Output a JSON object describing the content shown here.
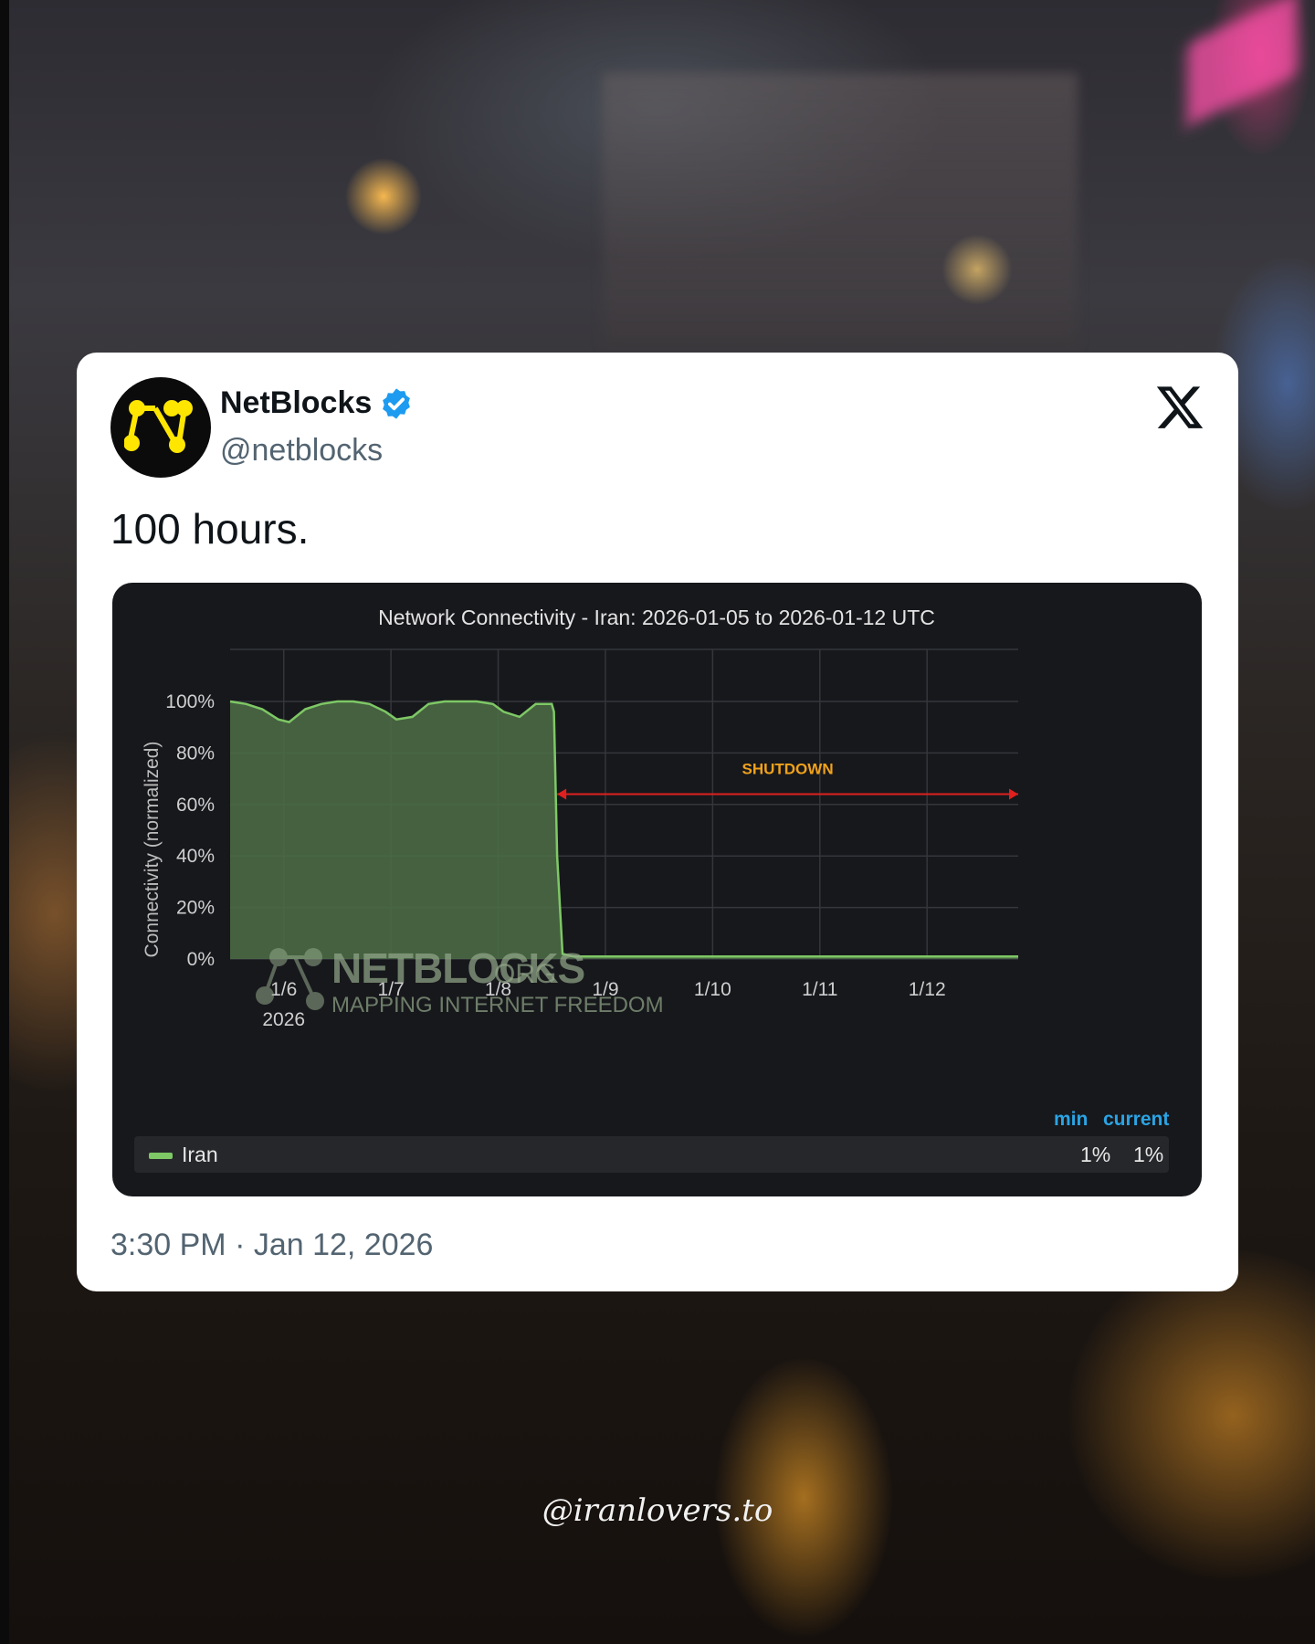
{
  "tweet": {
    "author_name": "NetBlocks",
    "author_handle": "@netblocks",
    "text": "100 hours.",
    "timestamp": "3:30 PM · Jan 12, 2026"
  },
  "overlay": {
    "handle": "@iranlovers.to"
  },
  "icons": {
    "avatar": "netblocks-logo-icon",
    "verified": "verified-badge-icon",
    "brand": "x-logo-icon"
  },
  "colors": {
    "area_fill": "#4d6e47",
    "area_line": "#7ec865",
    "annotation": "#e0201f",
    "annotation_text": "#f0a21b",
    "legend_header": "#2ba4e4",
    "verified": "#1d9bf0"
  },
  "chart_data": {
    "type": "area",
    "title": "Network Connectivity - Iran: 2026-01-05 to 2026-01-12 UTC",
    "ylabel": "Connectivity (normalized)",
    "xlabel": "",
    "ylim": [
      0,
      100
    ],
    "yticks": [
      "0%",
      "20%",
      "40%",
      "60%",
      "80%",
      "100%"
    ],
    "xtick_labels": [
      {
        "label": "1/6",
        "sub": "2026",
        "day": 6
      },
      {
        "label": "1/7",
        "sub": "",
        "day": 7
      },
      {
        "label": "1/8",
        "sub": "",
        "day": 8
      },
      {
        "label": "1/9",
        "sub": "",
        "day": 9
      },
      {
        "label": "1/10",
        "sub": "",
        "day": 10
      },
      {
        "label": "1/11",
        "sub": "",
        "day": 11
      },
      {
        "label": "1/12",
        "sub": "",
        "day": 12
      }
    ],
    "xlim_days": [
      5.5,
      12.85
    ],
    "grid": true,
    "series": [
      {
        "name": "Iran",
        "x_days": [
          5.5,
          5.65,
          5.8,
          5.95,
          6.05,
          6.2,
          6.35,
          6.5,
          6.65,
          6.8,
          6.95,
          7.05,
          7.2,
          7.35,
          7.5,
          7.65,
          7.8,
          7.95,
          8.05,
          8.2,
          8.35,
          8.45,
          8.5,
          8.52,
          8.55,
          8.6,
          8.7,
          9.0,
          10.0,
          11.0,
          12.0,
          12.85
        ],
        "values": [
          100,
          99,
          97,
          93,
          92,
          97,
          99,
          100,
          100,
          99,
          96,
          93,
          94,
          99,
          100,
          100,
          100,
          99,
          96,
          94,
          99,
          99,
          99,
          96,
          40,
          2,
          1,
          1,
          1,
          1,
          1,
          1
        ]
      }
    ],
    "annotations": [
      {
        "text": "SHUTDOWN",
        "from_day": 8.55,
        "to_day": 12.85,
        "y": 64
      }
    ],
    "watermark": {
      "brand": "NETBLOCKS",
      "suffix": "ORG",
      "tagline": "MAPPING INTERNET FREEDOM"
    },
    "legend": {
      "headers": [
        "min",
        "current"
      ],
      "rows": [
        {
          "name": "Iran",
          "min": "1%",
          "current": "1%"
        }
      ]
    }
  }
}
